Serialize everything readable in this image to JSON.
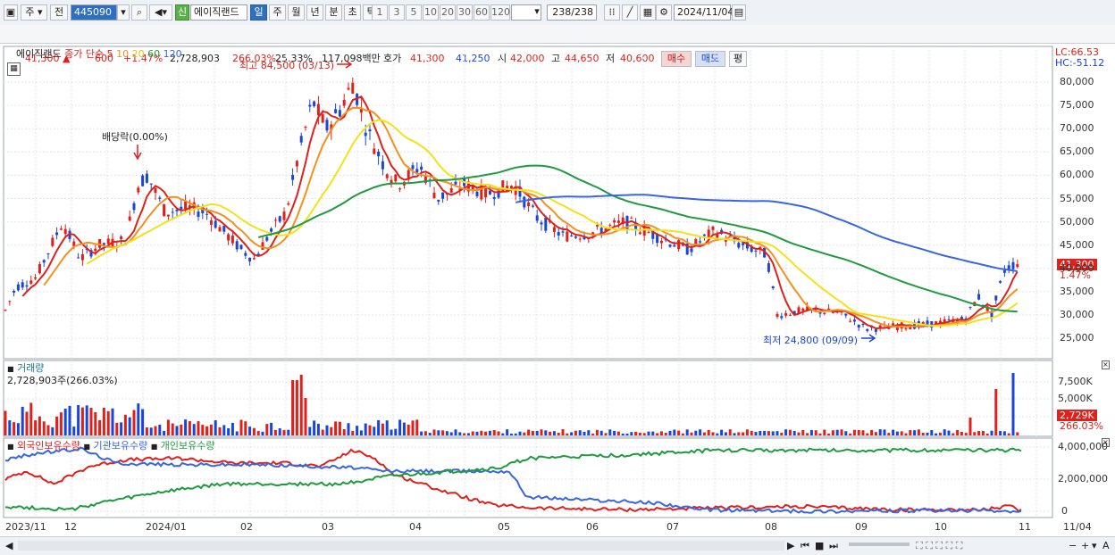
{
  "toolbar": {
    "market": "주",
    "period_mode": "전",
    "stock_code": "445090",
    "badge": "신",
    "stock_name": "에이직랜드",
    "periods": [
      "일",
      "주",
      "월",
      "년",
      "분",
      "초",
      "틱"
    ],
    "selected_period": "일",
    "intervals": [
      "1",
      "3",
      "5",
      "10",
      "20",
      "30",
      "60",
      "120"
    ],
    "count": "238",
    "count_total": "/238",
    "date": "2024/11/04"
  },
  "price_bar": {
    "price": "41,300",
    "change": "600",
    "change_pct": "+1.47%",
    "volume": "2,728,903",
    "volume_pct": "266.03%",
    "turnover": "25.33%",
    "amount": "117,098백만",
    "ask_label": "호가",
    "ask": "41,300",
    "bid": "41,250",
    "open_label": "시",
    "open": "42,000",
    "high_label": "고",
    "high": "44,650",
    "low_label": "저",
    "low": "40,600",
    "buy_btn": "매수",
    "sell_btn": "매도",
    "eval_btn": "평"
  },
  "colors": {
    "up": "#e0201b",
    "down": "#1a46d8",
    "ma5": "#e0201b",
    "ma10": "#f5901e",
    "ma20": "#f3e21a",
    "ma60": "#1f9a3f",
    "ma120": "#3866e0"
  },
  "price_pane": {
    "legend_name": "에이직랜드",
    "legend_type": "종가 단순",
    "ma_labels": [
      "5",
      "10",
      "20",
      "60",
      "120"
    ],
    "lc": "LC:66.53",
    "hc": "HC:-51.12",
    "high_annotation": "최고 84,500 (03/13)",
    "low_annotation": "최저 24,800 (09/09)",
    "dividend_annotation": "배당락(0.00%)",
    "current_price_tag": "41,300",
    "current_pct_tag": "1.47%",
    "y_ticks": [
      "80,000",
      "75,000",
      "70,000",
      "65,000",
      "60,000",
      "55,000",
      "50,000",
      "45,000",
      "40,000",
      "35,000",
      "30,000",
      "25,000"
    ]
  },
  "volume_pane": {
    "title": "거래량",
    "value_label": "2,728,903주(266.03%)",
    "y_ticks": [
      "7,500K",
      "5,000K"
    ],
    "current_tag": "2,729K",
    "current_pct": "266.03%"
  },
  "holdings_pane": {
    "legend": [
      "외국인보유수량",
      "기관보유수량",
      "개인보유수량"
    ],
    "y_ticks": [
      "4,000,000",
      "2,000,000",
      "0"
    ]
  },
  "x_axis": {
    "labels": [
      "2023/11",
      "12",
      "2024/01",
      "02",
      "03",
      "04",
      "05",
      "06",
      "07",
      "08",
      "09",
      "10",
      "11",
      "11/04"
    ]
  }
}
